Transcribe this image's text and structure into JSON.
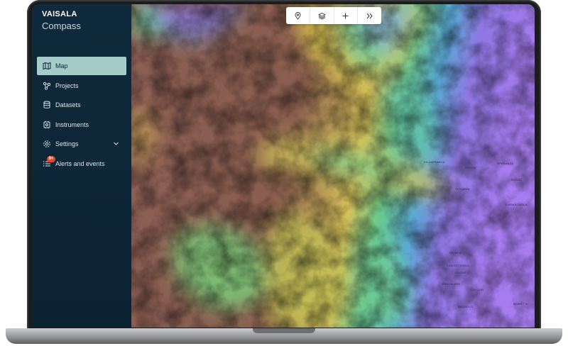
{
  "brand": {
    "name": "VAISALA",
    "app": "Compass"
  },
  "sidebar": {
    "items": [
      {
        "label": "Map",
        "icon": "map-icon",
        "active": true
      },
      {
        "label": "Projects",
        "icon": "projects-icon",
        "active": false
      },
      {
        "label": "Datasets",
        "icon": "database-icon",
        "active": false
      },
      {
        "label": "Instruments",
        "icon": "instrument-icon",
        "active": false
      },
      {
        "label": "Settings",
        "icon": "gear-icon",
        "active": false,
        "expandable": true
      },
      {
        "label": "Alerts and events",
        "icon": "list-icon",
        "active": false,
        "badge": "9+"
      }
    ]
  },
  "toolbar": {
    "tools": [
      "location-pin-icon",
      "layers-icon",
      "plus-icon",
      "double-chevron-right-icon"
    ]
  },
  "map": {
    "places": [
      "VILLAFRANCA",
      "MONTE",
      "SPERANZA",
      "GIOVANNI",
      "ROSSO",
      "CARMAGNOLA",
      "PIOBESI",
      "SAN SECONDO",
      "VIGONE",
      "PANCALIERI",
      "CAVOUR",
      "BAGNOLO",
      "MORETTA"
    ]
  },
  "colors": {
    "accent": "#a6ccc9",
    "sidebar": "#0f2a3c",
    "badge": "#e4472f"
  }
}
